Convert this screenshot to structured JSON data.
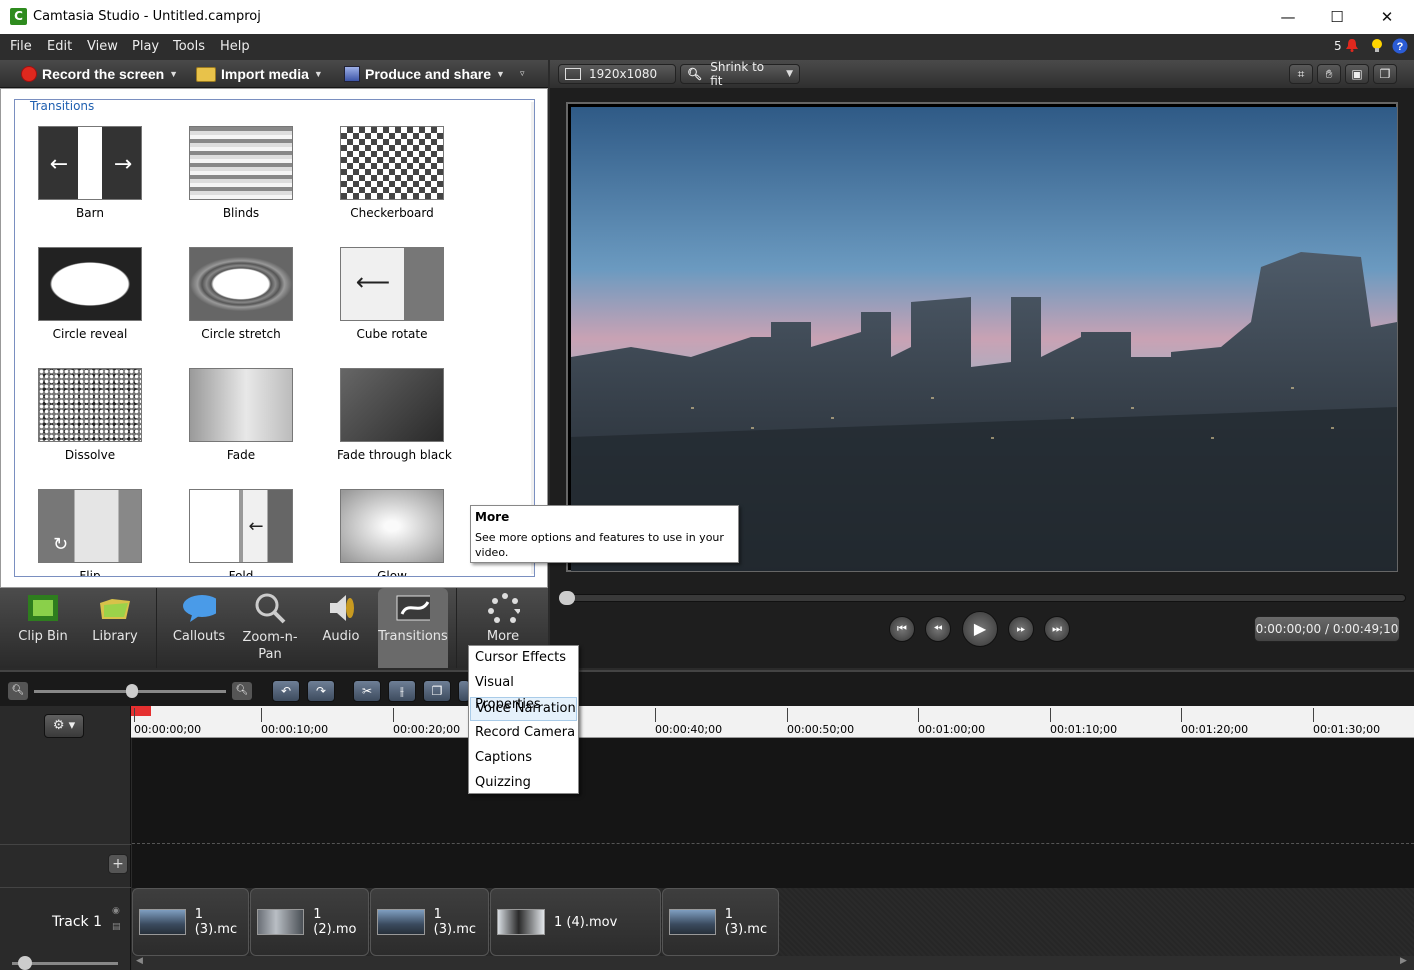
{
  "window": {
    "title": "Camtasia Studio - Untitled.camproj",
    "app_icon_letter": "C",
    "min": "—",
    "max": "☐",
    "close": "✕"
  },
  "menu": {
    "items": [
      "File",
      "Edit",
      "View",
      "Play",
      "Tools",
      "Help"
    ],
    "notifications_count": "5"
  },
  "toolbar": {
    "record": "Record the screen",
    "import": "Import media",
    "produce": "Produce and share"
  },
  "transitions": {
    "group_label": "Transitions",
    "items": [
      {
        "label": "Barn"
      },
      {
        "label": "Blinds"
      },
      {
        "label": "Checkerboard"
      },
      {
        "label": "Circle reveal"
      },
      {
        "label": "Circle stretch"
      },
      {
        "label": "Cube rotate"
      },
      {
        "label": "Dissolve"
      },
      {
        "label": "Fade"
      },
      {
        "label": "Fade through black"
      },
      {
        "label": "Flip"
      },
      {
        "label": "Fold"
      },
      {
        "label": "Glow"
      }
    ]
  },
  "tabs": [
    {
      "label": "Clip Bin",
      "icon": "film-strip-icon"
    },
    {
      "label": "Library",
      "icon": "folder-icon"
    },
    {
      "label": "Callouts",
      "icon": "speech-bubble-icon"
    },
    {
      "label": "Zoom-n-Pan",
      "icon": "magnifier-icon"
    },
    {
      "label": "Audio",
      "icon": "speaker-icon"
    },
    {
      "label": "Transitions",
      "icon": "transition-icon"
    },
    {
      "label": "More",
      "icon": "dots-icon"
    }
  ],
  "preview": {
    "resolution": "1920x1080",
    "zoom": "Shrink to fit",
    "timecode": "0:00:00;00 / 0:00:49;10"
  },
  "tooltip": {
    "title": "More",
    "body": "See more options and features to use in your video."
  },
  "more_menu": {
    "items": [
      "Cursor Effects",
      "Visual Properties",
      "Voice Narration",
      "Record Camera",
      "Captions",
      "Quizzing"
    ],
    "selected_index": 2
  },
  "timeline": {
    "ruler_labels": [
      "00:00:00;00",
      "00:00:10;00",
      "00:00:20;00",
      "00:00:40;00",
      "00:00:50;00",
      "00:01:00;00",
      "00:01:10;00",
      "00:01:20;00",
      "00:01:30;00"
    ],
    "track_name": "Track 1",
    "clips": [
      "1 (3).mc",
      "1 (2).mo",
      "1 (3).mc",
      "1 (4).mov",
      "1 (3).mc"
    ]
  },
  "colors": {
    "accent_record": "#e0281e",
    "panel_border": "#7a8fc0"
  }
}
